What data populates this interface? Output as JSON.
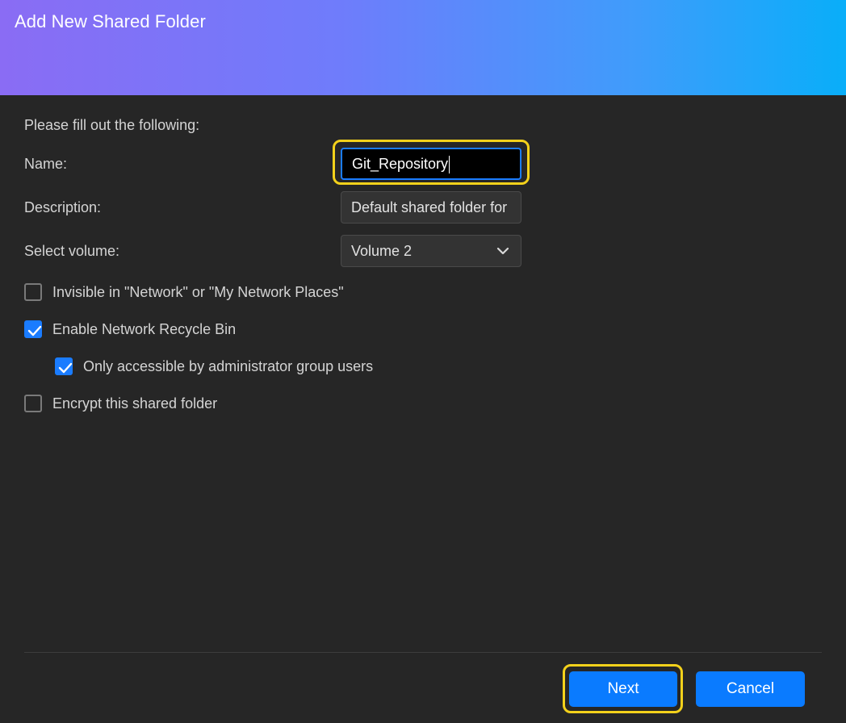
{
  "dialog": {
    "title": "Add New Shared Folder",
    "intro": "Please fill out the following:"
  },
  "form": {
    "name_label": "Name:",
    "name_value": "Git_Repository",
    "description_label": "Description:",
    "description_value": "Default shared folder for",
    "volume_label": "Select volume:",
    "volume_value": "Volume 2"
  },
  "options": [
    {
      "label": "Invisible in \"Network\" or \"My Network Places\"",
      "checked": false
    },
    {
      "label": "Enable Network Recycle Bin",
      "checked": true
    },
    {
      "label": "Only accessible by administrator group users",
      "checked": true
    },
    {
      "label": "Encrypt this shared folder",
      "checked": false
    }
  ],
  "buttons": {
    "next": "Next",
    "cancel": "Cancel"
  },
  "colors": {
    "accent": "#0a7bff",
    "highlight": "#f3d11b",
    "background": "#262626"
  },
  "icons": {
    "select_arrow": "chevron-down-icon",
    "check": "checkmark-icon"
  }
}
